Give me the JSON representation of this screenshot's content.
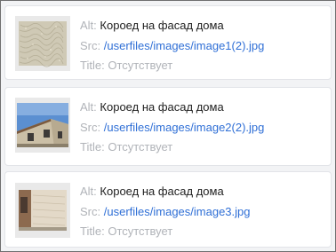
{
  "labels": {
    "alt": "Alt:",
    "src": "Src:",
    "title": "Title:"
  },
  "colors": {
    "label": "#b0b3b8",
    "value": "#222222",
    "link": "#2f6fd6",
    "card_bg": "#ffffff",
    "panel_bg": "#f2f3f5"
  },
  "images": [
    {
      "alt": "Короед на фасад дома",
      "src": "/userfiles/images/image1(2).jpg",
      "title": "Отсутствует",
      "thumbnail": "stucco-texture"
    },
    {
      "alt": "Короед на фасад дома",
      "src": "/userfiles/images/image2(2).jpg",
      "title": "Отсутствует",
      "thumbnail": "house-facade-sky"
    },
    {
      "alt": "Короед на фасад дома",
      "src": "/userfiles/images/image3.jpg",
      "title": "Отсутствует",
      "thumbnail": "facade-wall-corner"
    }
  ]
}
